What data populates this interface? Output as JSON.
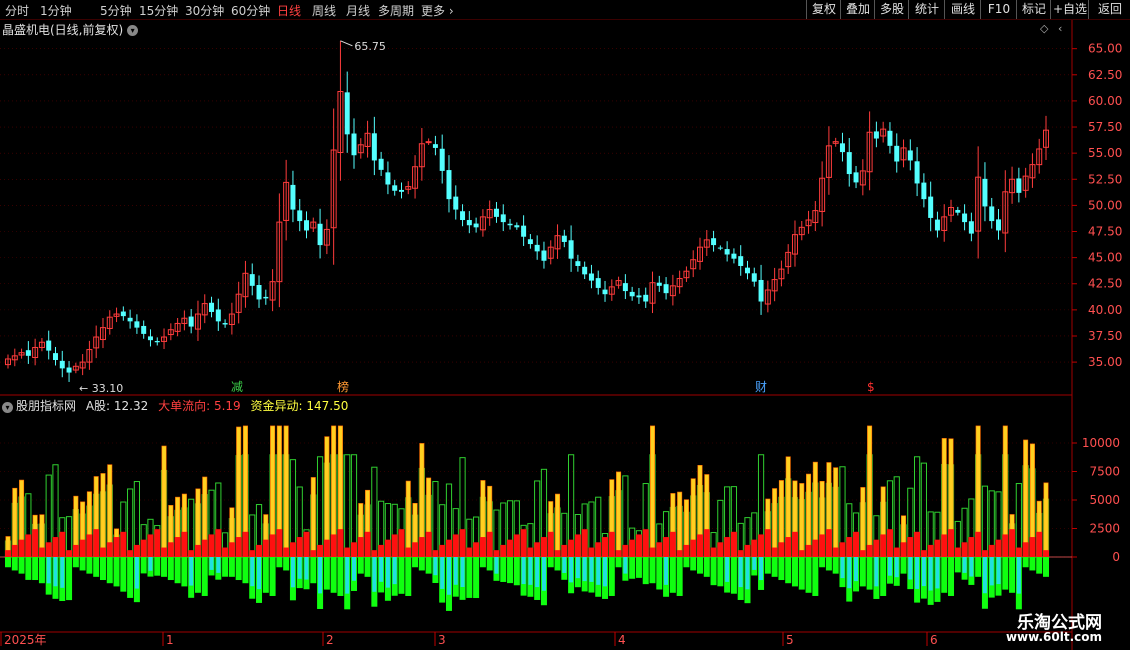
{
  "topbar": {
    "periods": [
      "分时",
      "1分钟",
      "5分钟",
      "15分钟",
      "30分钟",
      "60分钟",
      "日线",
      "周线",
      "月线",
      "多周期",
      "更多 ›"
    ],
    "active_period": "日线",
    "buttons": [
      "复权",
      "叠加",
      "多股",
      "统计",
      "画线",
      "F10",
      "标记",
      "+自选",
      "返回"
    ]
  },
  "kline": {
    "title": "晶盛机电(日线,前复权)",
    "high_label": "65.75",
    "low_label": "33.10",
    "price_axis": [
      "65.00",
      "62.50",
      "60.00",
      "57.50",
      "55.00",
      "52.50",
      "50.00",
      "47.50",
      "45.00",
      "42.50",
      "40.00",
      "37.50",
      "35.00"
    ],
    "markers": [
      {
        "text": "减",
        "color": "#3cd04a"
      },
      {
        "text": "榜",
        "color": "#ff9933"
      },
      {
        "text": "财",
        "color": "#4aa3ff"
      },
      {
        "text": "$",
        "color": "#ff3030"
      }
    ],
    "up_color": "#ff3c3c",
    "down_color": "#54ffff"
  },
  "indicator": {
    "name": "股朋指标网",
    "a_label": "A股: 12.32",
    "big_order_label": "大单流向: 5.19",
    "fund_label": "资金异动: 147.50",
    "axis": [
      "10000",
      "7500",
      "5000",
      "2500",
      "0"
    ]
  },
  "timeline": {
    "labels": [
      "2025年",
      "1",
      "2",
      "3",
      "4",
      "5",
      "6"
    ]
  },
  "watermark": {
    "cn": "乐淘公式网",
    "url": "www.60lt.com"
  },
  "chart_data": {
    "type": "candlestick",
    "title": "晶盛机电(日线,前复权)",
    "ylim": [
      33,
      66.5
    ],
    "y_ticks": [
      35,
      37.5,
      40,
      42.5,
      45,
      47.5,
      50,
      52.5,
      55,
      57.5,
      60,
      62.5,
      65
    ],
    "high": 65.75,
    "low": 33.1,
    "close_series": [
      35.3,
      35.6,
      35.9,
      35.6,
      36.4,
      36.9,
      36.1,
      35.2,
      34.4,
      34.0,
      34.6,
      35.0,
      36.2,
      37.4,
      38.3,
      39.3,
      39.6,
      39.4,
      38.9,
      38.3,
      37.7,
      37.1,
      36.9,
      37.4,
      38.1,
      38.7,
      39.2,
      38.4,
      39.6,
      40.6,
      39.8,
      38.9,
      38.6,
      39.6,
      41.5,
      43.5,
      42.3,
      41.0,
      41.1,
      42.7,
      48.4,
      52.2,
      49.6,
      48.5,
      47.6,
      48.4,
      46.2,
      47.7,
      55.3,
      60.9,
      56.8,
      54.8,
      55.8,
      56.9,
      54.3,
      53.4,
      52.0,
      51.4,
      51.3,
      51.8,
      53.7,
      55.9,
      56.1,
      55.5,
      53.3,
      50.6,
      49.6,
      48.6,
      48.1,
      47.9,
      48.9,
      49.6,
      48.9,
      48.4,
      48.1,
      47.9,
      47.0,
      46.3,
      45.6,
      44.7,
      46.0,
      47.1,
      46.5,
      44.9,
      44.2,
      43.4,
      42.8,
      42.1,
      41.5,
      42.2,
      42.8,
      41.8,
      41.3,
      41.2,
      40.8,
      42.6,
      42.3,
      41.6,
      42.3,
      43.0,
      43.7,
      44.8,
      46.0,
      46.7,
      46.2,
      45.9,
      45.3,
      44.9,
      44.2,
      43.5,
      42.7,
      40.8,
      41.9,
      42.9,
      43.9,
      45.5,
      47.2,
      47.9,
      48.6,
      49.5,
      52.6,
      55.7,
      56.1,
      55.1,
      53.0,
      52.2,
      53.3,
      57.0,
      56.4,
      57.3,
      55.7,
      54.2,
      55.5,
      54.3,
      52.1,
      50.6,
      48.8,
      47.6,
      48.9,
      49.8,
      49.3,
      48.4,
      47.3,
      52.7,
      49.9,
      48.5,
      47.6,
      51.3,
      52.5,
      51.2,
      52.8,
      53.9,
      55.4,
      57.2
    ]
  }
}
